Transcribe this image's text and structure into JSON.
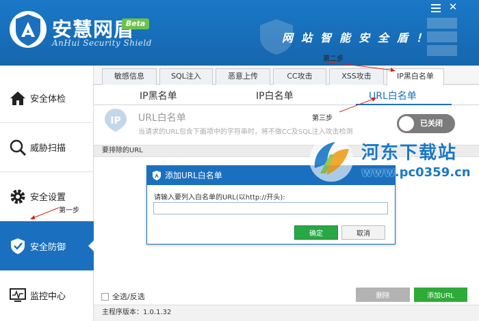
{
  "app": {
    "name": "安慧网盾",
    "badge": "Beta",
    "subtitle": "AnHui Security Shield",
    "slogan": "网站智能安全盾！"
  },
  "sidebar": {
    "items": [
      {
        "label": "安全体检",
        "icon": "home-icon"
      },
      {
        "label": "威胁扫描",
        "icon": "magnifier-icon"
      },
      {
        "label": "安全设置",
        "icon": "gear-icon"
      },
      {
        "label": "安全防御",
        "icon": "shield-icon"
      },
      {
        "label": "监控中心",
        "icon": "monitor-icon"
      }
    ],
    "active_index": 3
  },
  "tabs": [
    "敏感信息",
    "SQL注入",
    "恶意上传",
    "CC攻击",
    "XSS攻击",
    "IP黑白名单"
  ],
  "active_tab": "IP黑白名单",
  "subtabs": [
    "IP黑名单",
    "IP白名单",
    "URL白名单"
  ],
  "active_subtab": "URL白名单",
  "section": {
    "title": "URL白名单",
    "description": "当请求的URL包含下面项中的字符串时，将不做CC及SQL注入攻击检测",
    "icon_text": "IP",
    "toggle_label": "已关闭",
    "toggle_on": false
  },
  "list": {
    "header": "要排除的URL"
  },
  "dialog": {
    "title": "添加URL白名单",
    "prompt": "请输入要列入白名单的URL(以http://开头):",
    "input_value": "",
    "ok_label": "确定",
    "cancel_label": "取消"
  },
  "footer": {
    "select_all_label": "全选/反选",
    "delete_label": "删除",
    "add_label": "添加URL",
    "version_label": "主程序版本：1.0.1.32"
  },
  "annotations": {
    "step1": "第一步",
    "step2": "第二步",
    "step3": "第三步"
  },
  "watermark": {
    "text": "河东下载站",
    "url": "www.pc0359.cn"
  },
  "colors": {
    "brand_blue": "#1a70bf",
    "header_blue": "#1a78c7",
    "badge_green": "#6cc34a",
    "ok_green": "#28a745",
    "toggle_grey": "#7b7b7b",
    "annotation_red": "#dd1111"
  }
}
